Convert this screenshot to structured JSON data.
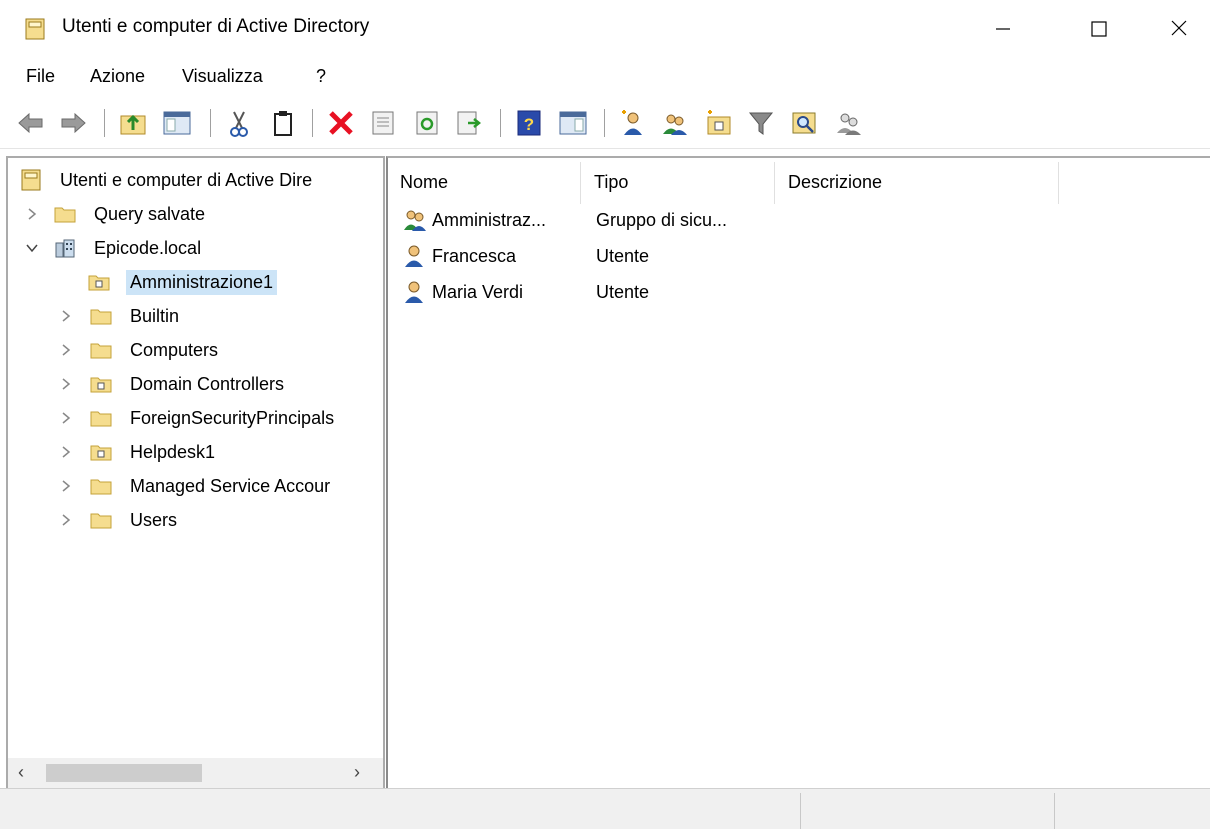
{
  "window": {
    "title": "Utenti e computer di Active Directory",
    "controls": [
      "minimize-icon",
      "maximize-icon",
      "close-icon"
    ]
  },
  "menu": {
    "items": [
      "File",
      "Azione",
      "Visualizza",
      "?"
    ]
  },
  "toolbar": {
    "buttons": [
      "back-arrow-icon",
      "forward-arrow-icon",
      "up-folder-icon",
      "show-hide-console-tree-icon",
      "cut-icon",
      "clipboard-icon",
      "delete-icon",
      "properties-icon",
      "refresh-icon",
      "export-list-icon",
      "help-icon",
      "show-hide-action-pane-icon",
      "new-user-icon",
      "new-group-icon",
      "new-ou-icon",
      "filter-icon",
      "find-icon",
      "add-to-group-icon"
    ]
  },
  "tree": {
    "root": "Utenti e computer di Active Dire",
    "items": [
      {
        "label": "Query salvate",
        "level": 1,
        "expander": "collapsed",
        "icon": "folder-icon"
      },
      {
        "label": "Epicode.local",
        "level": 1,
        "expander": "expanded",
        "icon": "domain-icon"
      },
      {
        "label": "Amministrazione1",
        "level": 2,
        "expander": "none",
        "icon": "ou-folder-icon",
        "selected": true
      },
      {
        "label": "Builtin",
        "level": 2,
        "expander": "collapsed",
        "icon": "folder-icon"
      },
      {
        "label": "Computers",
        "level": 2,
        "expander": "collapsed",
        "icon": "folder-icon"
      },
      {
        "label": "Domain Controllers",
        "level": 2,
        "expander": "collapsed",
        "icon": "ou-folder-icon"
      },
      {
        "label": "ForeignSecurityPrincipals",
        "level": 2,
        "expander": "collapsed",
        "icon": "folder-icon"
      },
      {
        "label": "Helpdesk1",
        "level": 2,
        "expander": "collapsed",
        "icon": "ou-folder-icon"
      },
      {
        "label": "Managed Service Accour",
        "level": 2,
        "expander": "collapsed",
        "icon": "folder-icon"
      },
      {
        "label": "Users",
        "level": 2,
        "expander": "collapsed",
        "icon": "folder-icon"
      }
    ]
  },
  "list": {
    "columns": [
      "Nome",
      "Tipo",
      "Descrizione"
    ],
    "rows": [
      {
        "name": "Amministraz...",
        "type": "Gruppo di sicu...",
        "icon": "group-icon"
      },
      {
        "name": "Francesca",
        "type": "Utente",
        "icon": "user-icon"
      },
      {
        "name": "Maria Verdi",
        "type": "Utente",
        "icon": "user-icon"
      }
    ]
  },
  "colors": {
    "selection": "#cce4f7",
    "folder": "#f5dd8f",
    "delete": "#e81123"
  }
}
